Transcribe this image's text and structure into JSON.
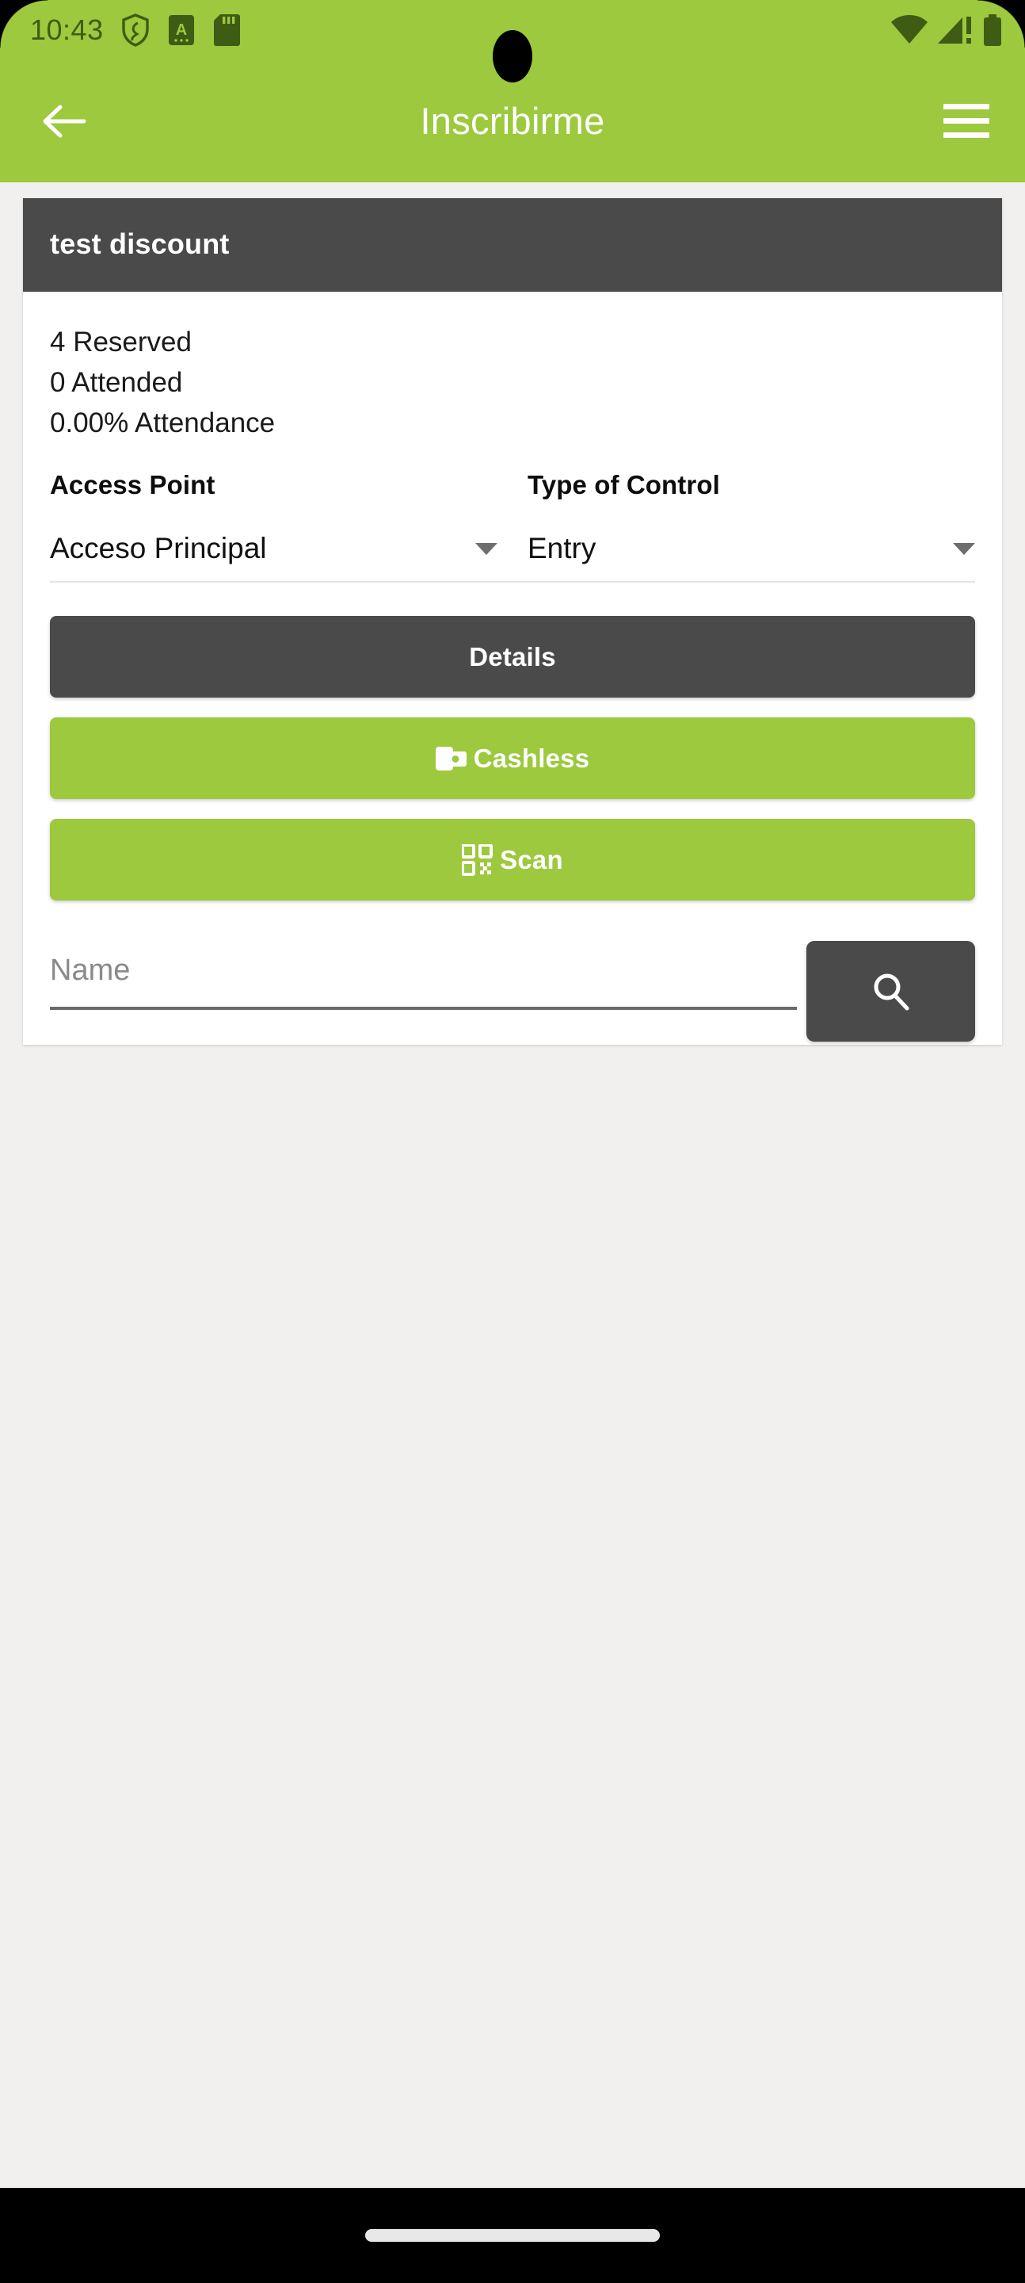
{
  "statusbar": {
    "time": "10:43",
    "left_icons": [
      "shield-icon",
      "a-badge-icon",
      "sd-card-icon"
    ],
    "right_icons": [
      "wifi-icon",
      "cellular-signal-warning-icon",
      "battery-icon"
    ],
    "background_color": "#9CC93D",
    "icon_color": "#3F5C14"
  },
  "appbar": {
    "title": "Inscribirme",
    "back_icon": "arrow-left-icon",
    "menu_icon": "hamburger-menu-icon",
    "background_color": "#9CC93D",
    "text_color": "#FFFFFF"
  },
  "card": {
    "header_title": "test discount",
    "header_background": "#4A4A4A",
    "stats": [
      "4 Reserved",
      "0 Attended",
      "0.00% Attendance"
    ],
    "selects": [
      {
        "label": "Access Point",
        "value": "Acceso Principal",
        "caret_icon": "chevron-down-icon"
      },
      {
        "label": "Type of Control",
        "value": "Entry",
        "caret_icon": "chevron-down-icon"
      }
    ],
    "buttons": [
      {
        "label": "Details",
        "style": "dark",
        "icon": null,
        "color": "#4A4A4A"
      },
      {
        "label": "Cashless",
        "style": "green",
        "icon": "wallet-icon",
        "color": "#9CC93D"
      },
      {
        "label": "Scan",
        "style": "green",
        "icon": "qr-code-icon",
        "color": "#9CC93D"
      }
    ],
    "search": {
      "placeholder": "Name",
      "value": "",
      "button_icon": "search-icon"
    }
  },
  "navbar": {
    "handle": "gesture-handle"
  }
}
